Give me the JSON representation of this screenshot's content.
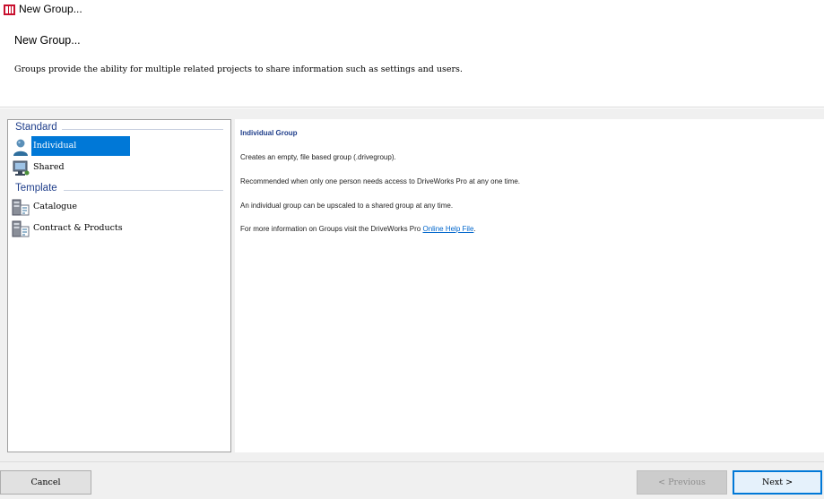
{
  "window": {
    "title": "New Group...",
    "icon": "driveworks-app-icon"
  },
  "header": {
    "title": "New Group...",
    "description": "Groups provide the ability for multiple related projects to share information such as settings and users."
  },
  "list": {
    "groups": [
      {
        "label": "Standard"
      },
      {
        "label": "Template"
      }
    ],
    "items": [
      {
        "label": "Individual",
        "icon": "person-icon",
        "selected": true
      },
      {
        "label": "Shared",
        "icon": "computer-users-icon",
        "selected": false
      },
      {
        "label": "Catalogue",
        "icon": "server-document-icon",
        "selected": false
      },
      {
        "label": "Contract & Products",
        "icon": "server-document-icon",
        "selected": false
      }
    ]
  },
  "detail": {
    "title": "Individual Group",
    "p1": "Creates an empty, file based group (.drivegroup).",
    "p2": "Recommended when only one person needs access to DriveWorks Pro at any one time.",
    "p3": "An individual group can be upscaled to a shared group at any time.",
    "p4_prefix": "For more information on Groups visit the DriveWorks Pro ",
    "p4_link": "Online Help File",
    "p4_suffix": "."
  },
  "footer": {
    "cancel_label": "Cancel",
    "previous_label": "< Previous",
    "next_label": "Next >",
    "previous_enabled": false
  },
  "colors": {
    "accent": "#0078d7",
    "group_header": "#1e3d8a",
    "link": "#0066cc"
  }
}
